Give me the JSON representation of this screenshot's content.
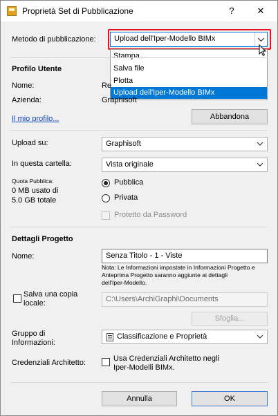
{
  "window": {
    "title": "Proprietà Set di Pubblicazione",
    "help_label": "?",
    "close_label": "✕"
  },
  "method": {
    "label": "Metodo di pubblicazione:",
    "selected": "Upload dell'Iper-Modello BIMx",
    "options": [
      "Stampa...",
      "Salva file",
      "Plotta",
      "Upload dell'Iper-Modello BIMx"
    ]
  },
  "profile": {
    "heading": "Profilo Utente",
    "name_label": "Nome:",
    "name_value": "Re",
    "company_label": "Azienda:",
    "company_value": "Graphisoft",
    "my_profile_link": "Il mio profilo...",
    "abandon_button": "Abbandona"
  },
  "upload": {
    "upload_to_label": "Upload su:",
    "upload_to_value": "Graphisoft",
    "folder_label": "In questa cartella:",
    "folder_value": "Vista originale",
    "quota_label": "Quota Pubblica:",
    "quota_used": "0 MB usato di",
    "quota_total": "5.0 GB totale",
    "public_label": "Pubblica",
    "private_label": "Privata",
    "password_label": "Protetto da Password"
  },
  "project": {
    "heading": "Dettagli Progetto",
    "name_label": "Nome:",
    "name_value": "Senza Titolo - 1 - Viste",
    "note_line1": "Nota: Le Informazioni impostate in Informazioni Progetto e",
    "note_line2": "Anteprima Progetto saranno aggiunte ai dettagli",
    "note_line3": "dell'Iper-Modello.",
    "save_copy_line1": "Salva una copia",
    "save_copy_line2": "locale:",
    "local_path": "C:\\Users\\ArchiGraphi\\Documents",
    "browse_button": "Sfoglia...",
    "info_group_line1": "Gruppo di",
    "info_group_line2": "Informazioni:",
    "info_group_value": "Classificazione e Proprietà",
    "credentials_label": "Credenziali Architetto:",
    "credentials_check_line1": "Usa Credenziali Architetto negli",
    "credentials_check_line2": "Iper-Modelli BIMx."
  },
  "footer": {
    "cancel": "Annulla",
    "ok": "OK"
  },
  "colors": {
    "highlight_border": "#e81123",
    "selection": "#0078d7",
    "link": "#0a3fbf"
  }
}
